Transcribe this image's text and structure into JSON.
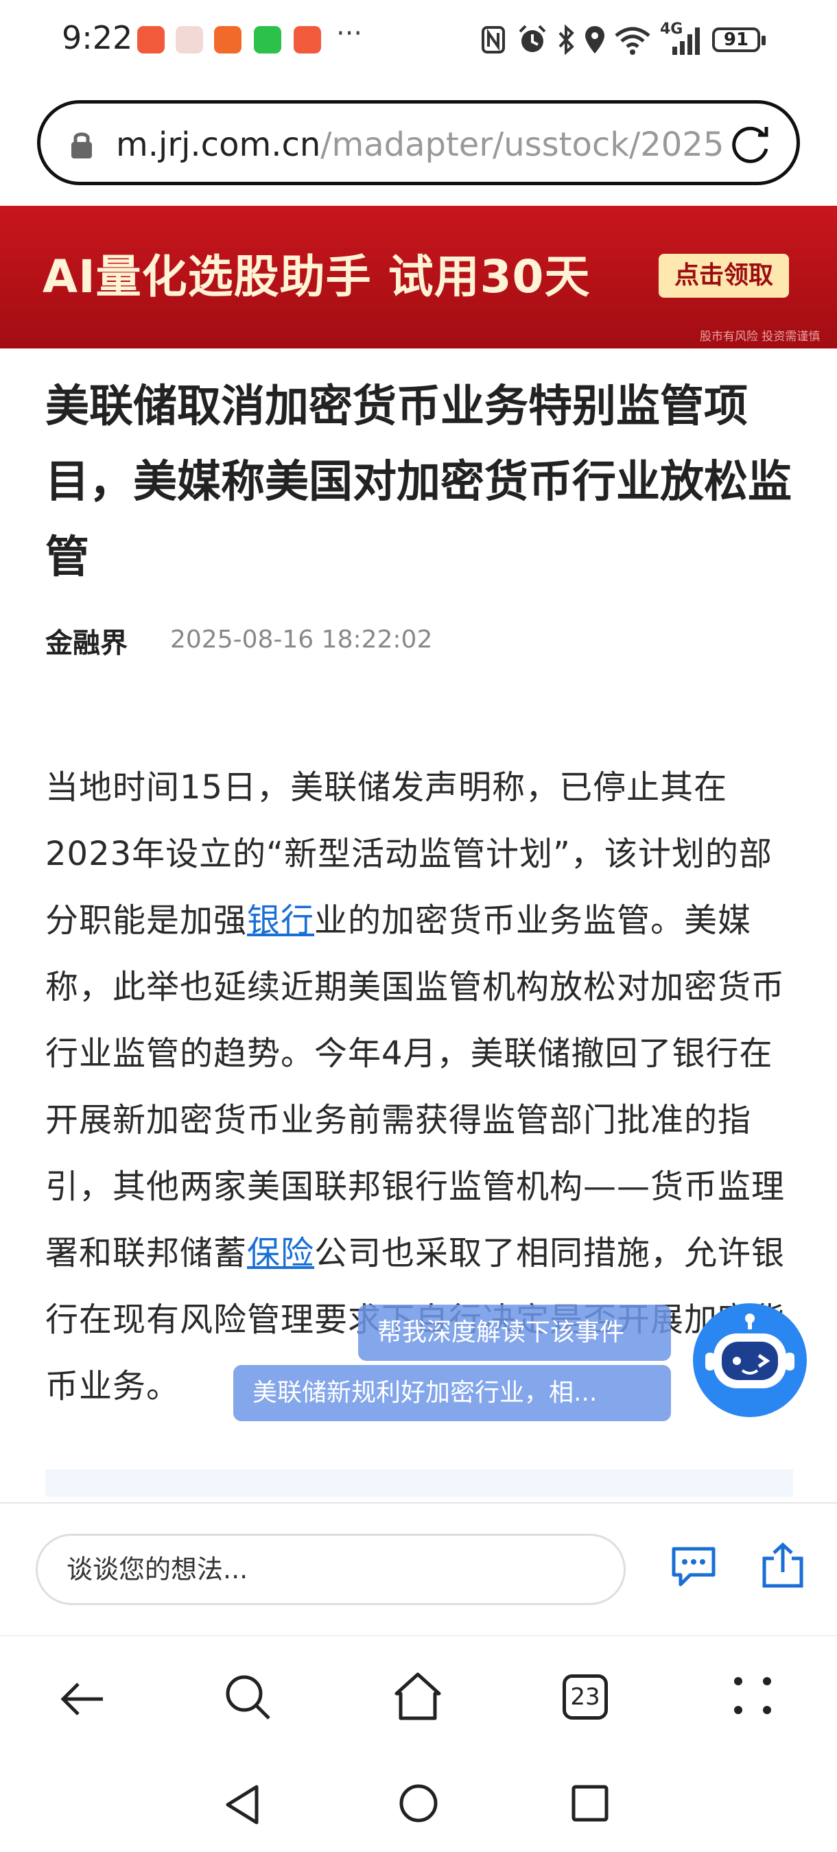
{
  "status_bar": {
    "time": "9:22",
    "more": "···",
    "network": "4G",
    "battery": "91"
  },
  "url_bar": {
    "domain": "m.jrj.com.cn",
    "path": "/madapter/usstock/2025"
  },
  "ad": {
    "title": "AI量化选股助手  试用30天",
    "button": "点击领取",
    "disclaimer": "股市有风险 投资需谨慎"
  },
  "article": {
    "title": "美联储取消加密货币业务特别监管项目，美媒称美国对加密货币行业放松监管",
    "source": "金融界",
    "time": "2025-08-16 18:22:02",
    "body_part1": "当地时间15日，美联储发声明称，已停止其在2023年设立的“新型活动监管计划”，该计划的部分职能是加强",
    "link1": "银行",
    "body_part2": "业的加密货币业务监管。美媒称，此举也延续近期美国监管机构放松对加密货币行业监管的趋势。今年4月，美联储撤回了银行在开展新加密货币业务前需获得监管部门批准的指引，其他两家美国联邦银行监管机构——货币监理署和联邦储蓄",
    "link2": "保险",
    "body_part3": "公司也采取了相同措施，允许银行在现有风险管理要求下自行决定是否开展加密货币业务。"
  },
  "ai_assistant": {
    "prompt1": "帮我深度解读下该事件",
    "prompt2": "美联储新规利好加密行业，相..."
  },
  "comment_bar": {
    "placeholder": "谈谈您的想法..."
  },
  "browser_nav": {
    "tab_count": "23"
  },
  "colors": {
    "ad_red": "#b31016",
    "link_blue": "#1a6fd4",
    "accent_blue": "#1a6fd4"
  }
}
